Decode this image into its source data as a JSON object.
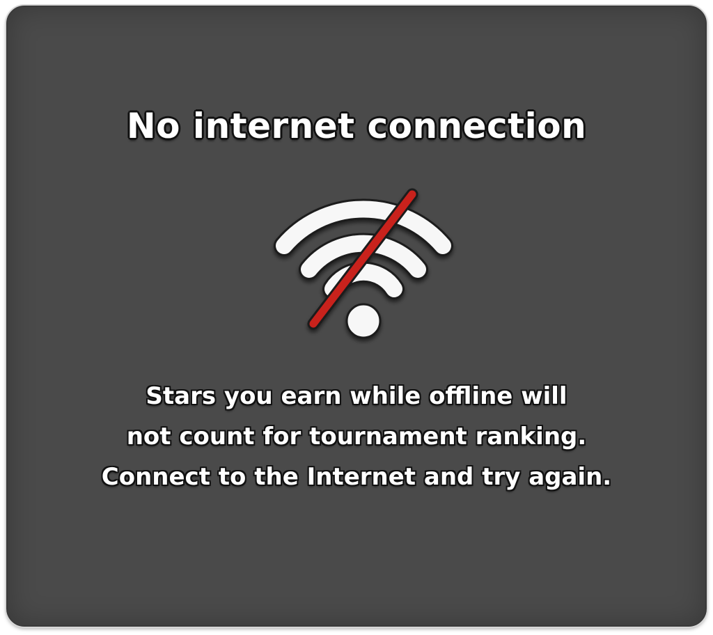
{
  "dialog": {
    "title": "No internet connection",
    "icon": "wifi-off-icon",
    "message_lines": [
      "Stars you earn while offline will",
      "not count for tournament ranking.",
      "Connect to the Internet and try again."
    ]
  },
  "colors": {
    "background": "#4a4a4a",
    "text": "#ffffff",
    "slash": "#c8201e"
  }
}
